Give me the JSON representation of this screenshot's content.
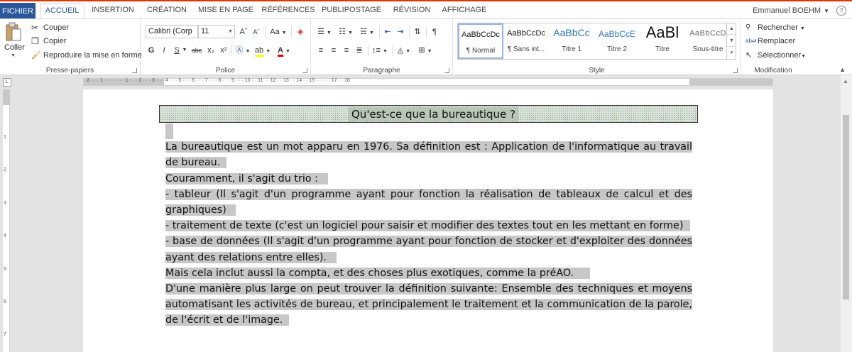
{
  "tabs": {
    "file": "FICHIER",
    "home": "ACCUEIL",
    "insert": "INSERTION",
    "design": "CRÉATION",
    "layout": "MISE EN PAGE",
    "references": "RÉFÉRENCES",
    "mailings": "PUBLIPOSTAGE",
    "review": "RÉVISION",
    "view": "AFFICHAGE"
  },
  "user": {
    "name": "Emmanuel BOEHM"
  },
  "ribbon": {
    "clipboard": {
      "label": "Presse-papiers",
      "paste": "Coller",
      "cut": "Couper",
      "copy": "Copier",
      "format_painter": "Reproduire la mise en forme"
    },
    "font": {
      "label": "Police",
      "font_name": "Calibri (Corp",
      "font_size": "11",
      "grow": "Aˆ",
      "shrink": "Aˇ",
      "case": "Aa",
      "bold": "G",
      "italic": "I",
      "underline": "S",
      "strike": "abc",
      "subscript": "x₂",
      "superscript": "x²"
    },
    "paragraph": {
      "label": "Paragraphe"
    },
    "styles": {
      "label": "Style",
      "items": [
        {
          "sample": "AaBbCcDc",
          "name": "¶ Normal"
        },
        {
          "sample": "AaBbCcDc",
          "name": "¶ Sans int..."
        },
        {
          "sample": "AaBbCc",
          "name": "Titre 1"
        },
        {
          "sample": "AaBbCcE",
          "name": "Titre 2"
        },
        {
          "sample": "AaBl",
          "name": "Titre"
        },
        {
          "sample": "AaBbCcD",
          "name": "Sous-titre"
        }
      ]
    },
    "editing": {
      "label": "Modification",
      "find": "Rechercher",
      "replace": "Remplacer",
      "select": "Sélectionner"
    }
  },
  "ruler": {
    "h_numbers": "· 2 · · · 1 · · · · · · · 1 · · · 2 · · · 3 · · · 4 · · · 5 · · · 6 · · · 7 · · · 8 · · · 9 · · · 10 · · 11 · · 12 · · 13 · · 14 · · 15 · · · · · 17 · · 18",
    "v_numbers": [
      "1",
      "2",
      "3",
      "4",
      "5",
      "6",
      "7"
    ]
  },
  "document": {
    "title": "Qu'est-ce que la bureautique ?",
    "lines": [
      "La bureautique est un mot apparu en 1976. Sa définition est : Application de l'informatique au travail",
      "de bureau.",
      "Couramment, il s'agit du trio :",
      "- tableur (Il s'agit d'un programme ayant pour fonction la réalisation de tableaux de calcul et des",
      "graphiques)",
      "- traitement de texte (c'est un logiciel pour saisir et modifier des textes tout en les mettant en forme)",
      "- base de données (Il s'agit d'un programme ayant pour fonction de stocker et d'exploiter des données",
      "ayant des relations entre elles).",
      "Mais cela inclut aussi la compta, et des choses plus exotiques, comme la préAO.",
      "D'une manière plus large on peut trouver la définition suivante: Ensemble des techniques et moyens",
      "automatisant les activités de bureau, et principalement le traitement et la communication de la parole,",
      "de l'écrit et de l'image."
    ]
  },
  "colors": {
    "file_tab": "#2b579a",
    "accent_top": "#d83b01",
    "selection": "#c7c7c7"
  }
}
